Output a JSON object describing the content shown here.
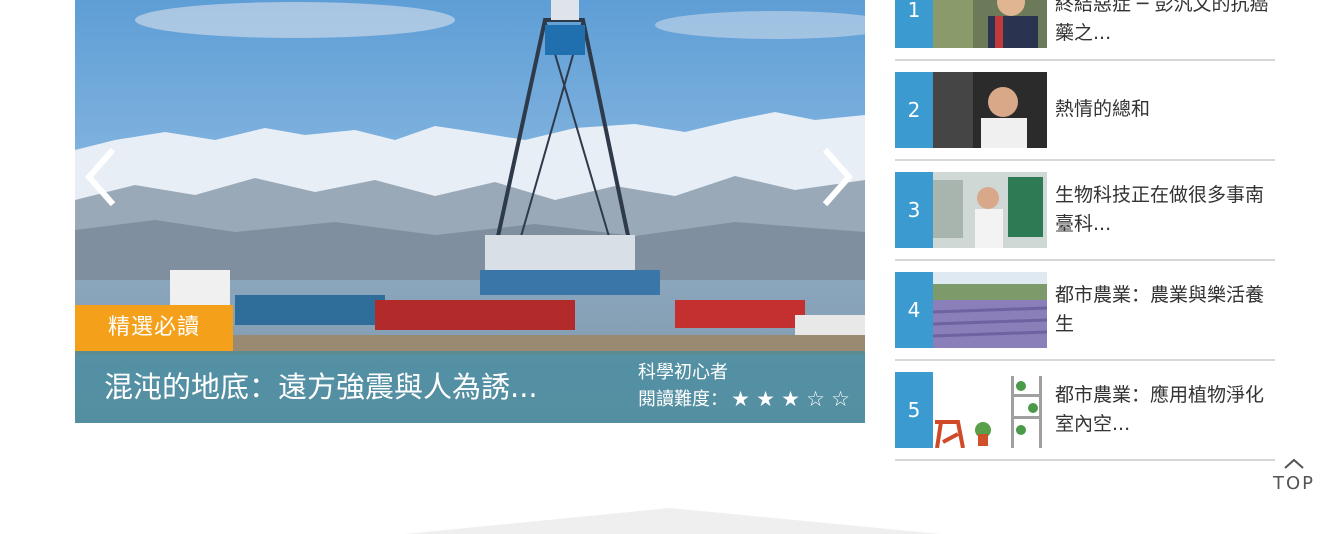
{
  "slider": {
    "badge": "精選必讀",
    "title": "混沌的地底：遠方強震與人為誘...",
    "audience": "科學初心者",
    "difficulty_label": "閱讀難度：",
    "difficulty_rating": 3,
    "difficulty_max": 5,
    "star_full": "★",
    "star_empty": "☆"
  },
  "ranking": [
    {
      "num": "1",
      "text": "終結惡症 ─ 彭汎文的抗癌藥之..."
    },
    {
      "num": "2",
      "text": "熱情的總和"
    },
    {
      "num": "3",
      "text": "生物科技正在做很多事南臺科..."
    },
    {
      "num": "4",
      "text": "都市農業：農業與樂活養生"
    },
    {
      "num": "5",
      "text": "都市農業：應用植物淨化室內空..."
    }
  ],
  "top_button": {
    "label": "TOP"
  },
  "colors": {
    "badge": "#f5a01a",
    "rank_number": "#3b9bd0",
    "caption_bar": "#428ca0"
  }
}
